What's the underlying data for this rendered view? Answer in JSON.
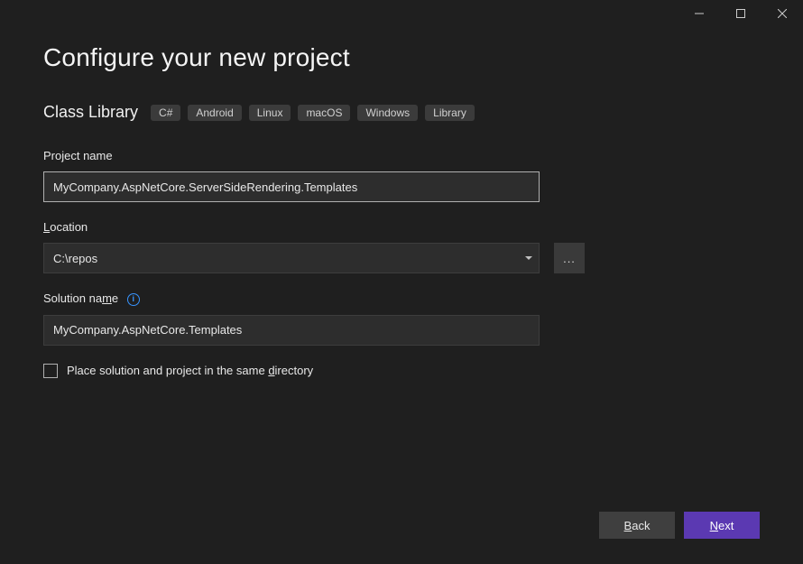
{
  "window": {
    "heading": "Configure your new project"
  },
  "template": {
    "name": "Class Library",
    "tags": [
      "C#",
      "Android",
      "Linux",
      "macOS",
      "Windows",
      "Library"
    ]
  },
  "fields": {
    "projectName": {
      "label": "Project name",
      "value": "MyCompany.AspNetCore.ServerSideRendering.Templates"
    },
    "location": {
      "label": "Location",
      "value": "C:\\repos",
      "browse": "..."
    },
    "solutionName": {
      "label": "Solution name",
      "value": "MyCompany.AspNetCore.Templates"
    },
    "sameDir": {
      "label": "Place solution and project in the same directory",
      "checked": false
    }
  },
  "buttons": {
    "back": "Back",
    "next": "Next"
  }
}
